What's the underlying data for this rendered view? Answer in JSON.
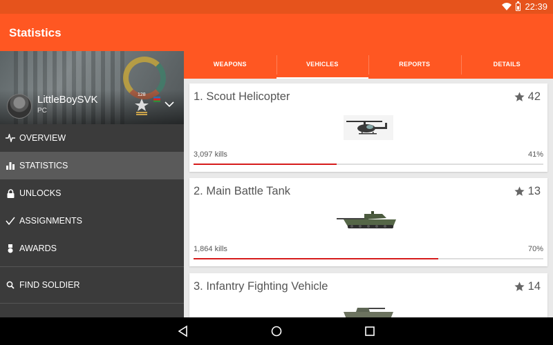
{
  "status_bar": {
    "time": "22:39",
    "icons": [
      "wifi-icon",
      "battery-icon"
    ]
  },
  "app_bar": {
    "title": "Statistics"
  },
  "tabs": [
    {
      "label": "WEAPONS",
      "active": false
    },
    {
      "label": "VEHICLES",
      "active": true
    },
    {
      "label": "REPORTS",
      "active": false
    },
    {
      "label": "DETAILS",
      "active": false
    }
  ],
  "profile": {
    "name": "LittleBoySVK",
    "platform": "PC",
    "rank": "128"
  },
  "drawer": {
    "items": [
      {
        "label": "OVERVIEW",
        "icon": "pulse-icon",
        "active": false
      },
      {
        "label": "STATISTICS",
        "icon": "bar-chart-icon",
        "active": true
      },
      {
        "label": "UNLOCKS",
        "icon": "lock-icon",
        "active": false
      },
      {
        "label": "ASSIGNMENTS",
        "icon": "check-icon",
        "active": false
      },
      {
        "label": "AWARDS",
        "icon": "medal-icon",
        "active": false
      }
    ],
    "find": {
      "label": "FIND SOLDIER",
      "icon": "search-icon"
    }
  },
  "vehicles": [
    {
      "title": "1. Scout Helicopter",
      "rank": "42",
      "kills": "3,097 kills",
      "percent": "41%",
      "progress": 0.41
    },
    {
      "title": "2. Main Battle Tank",
      "rank": "13",
      "kills": "1,864 kills",
      "percent": "70%",
      "progress": 0.7
    },
    {
      "title": "3. Infantry Fighting Vehicle",
      "rank": "14",
      "kills": "",
      "percent": "",
      "progress": 0
    }
  ],
  "colors": {
    "accent": "#ff5722",
    "status_bar": "#e6531c",
    "progress": "#d61a1a",
    "drawer": "#3b3b3b"
  }
}
